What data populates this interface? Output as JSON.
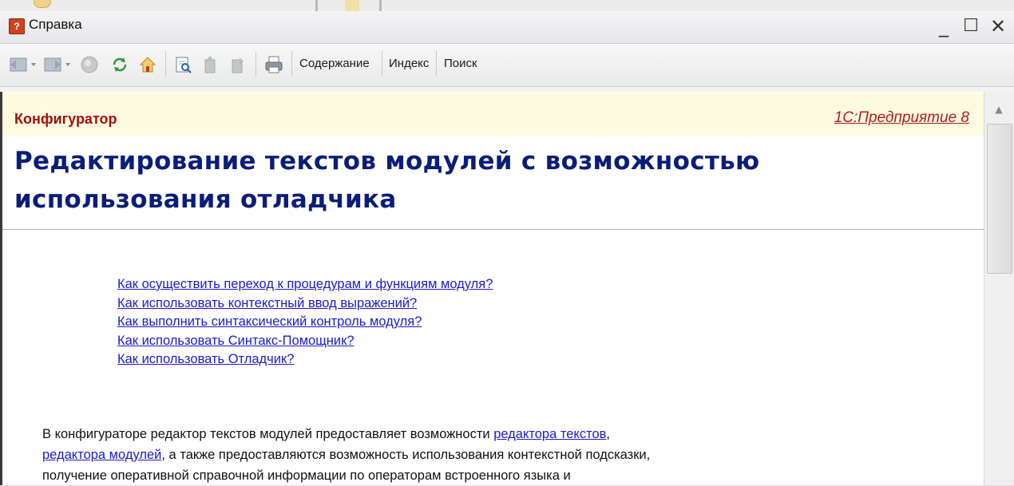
{
  "window": {
    "title": "Справка"
  },
  "window_controls": {
    "minimize": "_",
    "maximize": "☐",
    "close": "✕"
  },
  "toolbar": {
    "contents_label": "Содержание",
    "index_label": "Индекс",
    "search_label": "Поиск"
  },
  "page": {
    "section": "Конфигуратор",
    "product_link": "1С:Предприятие 8",
    "title": "Редактирование текстов модулей с возможностью использования отладчика",
    "links": [
      "Как осуществить переход к процедурам и функциям модуля?",
      "Как использовать контекстный ввод выражений?",
      "Как выполнить синтаксический контроль модуля?",
      "Как использовать Синтакс-Помощник?",
      "Как использовать Отладчик?"
    ],
    "paragraph": {
      "part1": "В конфигураторе редактор текстов модулей предоставляет возможности ",
      "link1": "редактора текстов",
      "part2": ",",
      "link2": "редактора модулей",
      "part3": ", а также предоставляются возможность использования контекстной подсказки,",
      "line3": "получение оперативной справочной информации по операторам встроенного языка и"
    }
  },
  "colors": {
    "header_band": "#fffbe0",
    "section_text": "#a01010",
    "title_text": "#0b1d7a",
    "link": "#1a1ad6"
  }
}
